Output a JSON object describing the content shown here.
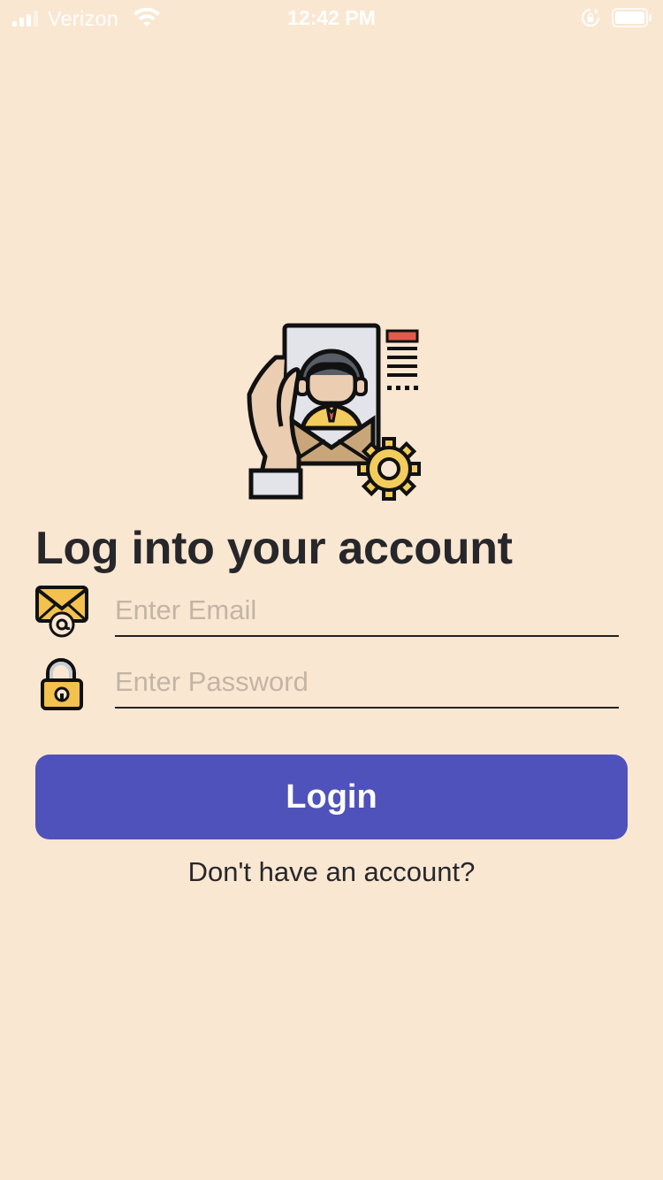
{
  "status_bar": {
    "carrier": "Verizon",
    "time": "12:42 PM",
    "signal_icon": "cellular-signal-icon",
    "wifi_icon": "wifi-icon",
    "rotation_lock_icon": "rotation-lock-icon",
    "battery_icon": "battery-icon"
  },
  "hero": {
    "icon": "hand-holding-id-card-with-gear-icon"
  },
  "login": {
    "title": "Log into your account",
    "email": {
      "icon": "envelope-at-icon",
      "placeholder": "Enter Email",
      "value": ""
    },
    "password": {
      "icon": "padlock-icon",
      "placeholder": "Enter Password",
      "value": ""
    },
    "login_label": "Login",
    "signup_link": "Don't have an account?"
  },
  "colors": {
    "background": "#FAE7D1",
    "button": "#4F52BA",
    "button_text": "#FFFFFF",
    "title_text": "#27272B",
    "placeholder_text": "#C2B5A5"
  }
}
